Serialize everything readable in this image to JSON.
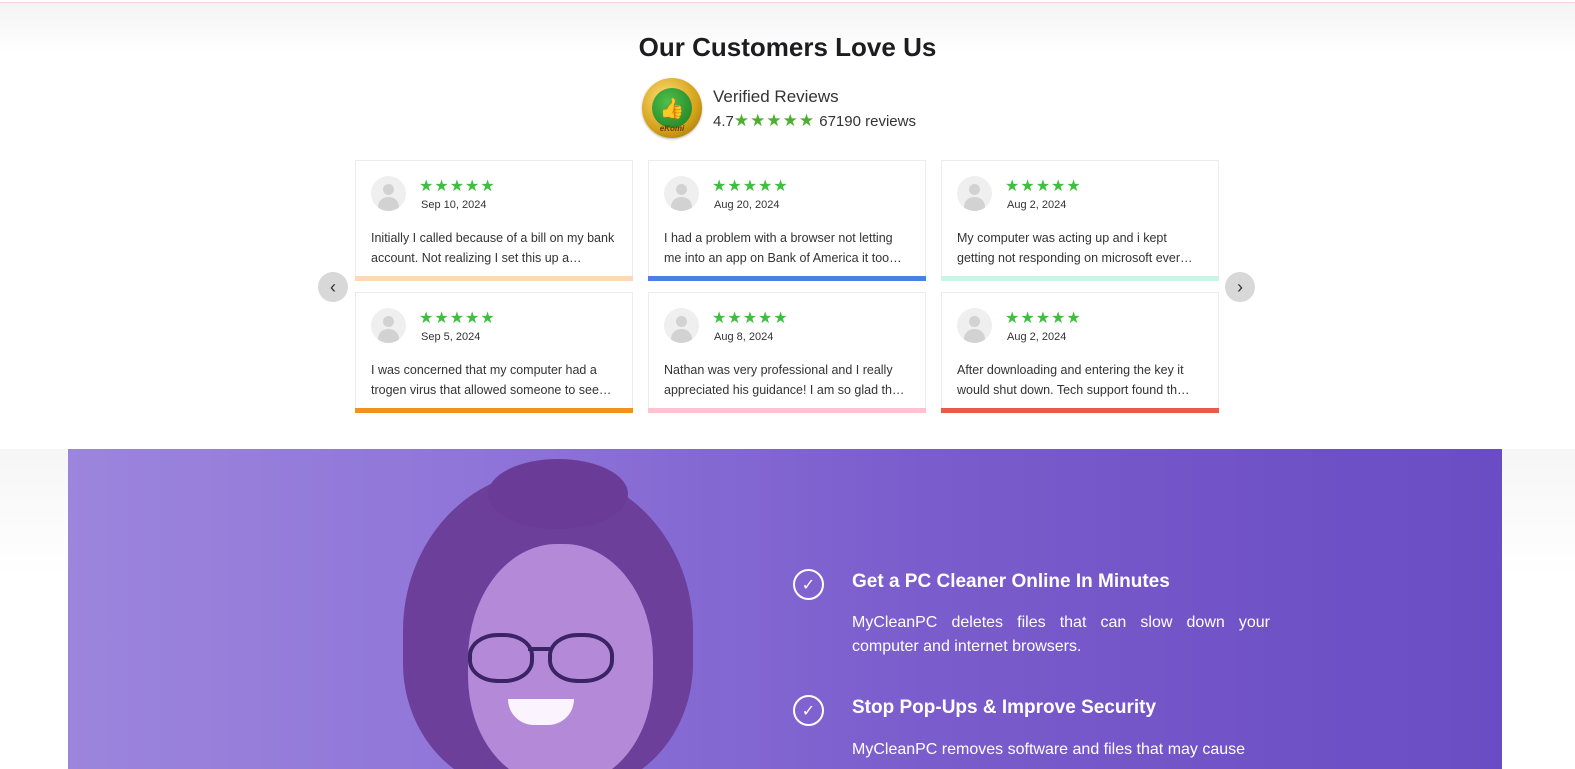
{
  "section_title": "Our Customers Love Us",
  "verified": {
    "badge_text": "eKomi",
    "title": "Verified Reviews",
    "rating": "4.7",
    "stars": "★★★★★",
    "count_text": "67190 reviews"
  },
  "carousel": {
    "prev_icon": "‹",
    "next_icon": "›"
  },
  "reviews": [
    {
      "stars": "★★★★★",
      "date": "Sep 10, 2024",
      "text": "Initially I called because of a bill on my bank account. Not realizing I set this up a…",
      "bar_color": "#ffd9b5"
    },
    {
      "stars": "★★★★★",
      "date": "Aug 20, 2024",
      "text": "I had a problem with a browser not letting me into an app on Bank of America it too…",
      "bar_color": "#4a7fe6"
    },
    {
      "stars": "★★★★★",
      "date": "Aug 2, 2024",
      "text": "My computer was acting up and i kept getting not responding on microsoft ever…",
      "bar_color": "#c9f5e6"
    },
    {
      "stars": "★★★★★",
      "date": "Sep 5, 2024",
      "text": "I was concerned that my computer had a trogen virus that allowed someone to see…",
      "bar_color": "#f0921e"
    },
    {
      "stars": "★★★★★",
      "date": "Aug 8, 2024",
      "text": "Nathan was very professional and I really appreciated his guidance! I am so glad th…",
      "bar_color": "#ffc3cf"
    },
    {
      "stars": "★★★★★",
      "date": "Aug 2, 2024",
      "text": "After downloading and entering the key it would shut down. Tech support found th…",
      "bar_color": "#e85a4a"
    }
  ],
  "features": [
    {
      "icon": "✓",
      "title": "Get a PC Cleaner Online In Minutes",
      "desc": "MyCleanPC deletes files that can slow down your computer and internet browsers."
    },
    {
      "icon": "✓",
      "title": "Stop Pop-Ups & Improve Security",
      "desc": "MyCleanPC removes software and files that may cause"
    }
  ]
}
